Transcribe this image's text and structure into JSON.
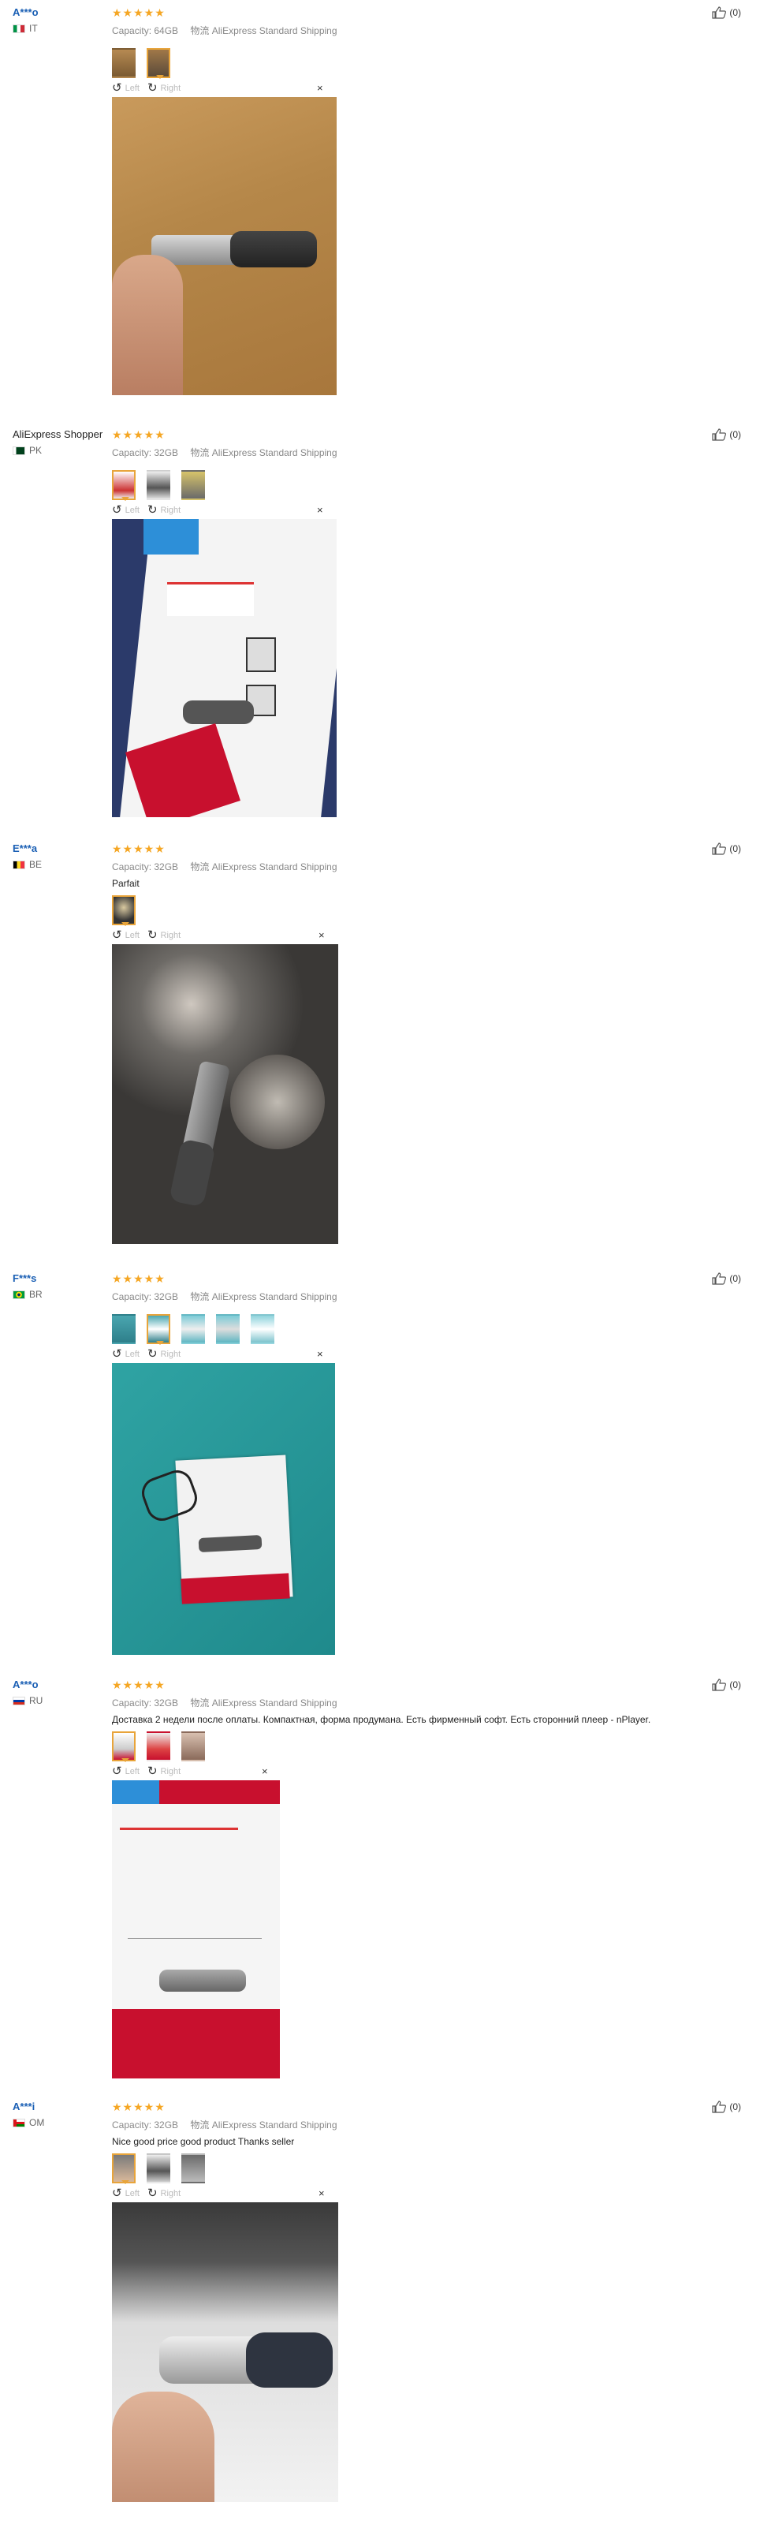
{
  "labels": {
    "capacity": "Capacity:",
    "shipping_icon_text": "物流",
    "rotate_left": "Left",
    "rotate_right": "Right",
    "close": "×"
  },
  "reviews": [
    {
      "user": "A***o",
      "country": "IT",
      "flag_colors": [
        "#009246",
        "#ffffff",
        "#ce2b37"
      ],
      "stars": "★★★★★",
      "capacity": "64GB",
      "shipping": "AliExpress Standard Shipping",
      "content": "",
      "helpful": "(0)",
      "thumb_count": 2,
      "active_thumb": 1
    },
    {
      "user": "AliExpress Shopper",
      "country": "PK",
      "flag_colors": [
        "#ffffff",
        "#01411c",
        "#01411c"
      ],
      "stars": "★★★★★",
      "capacity": "32GB",
      "shipping": "AliExpress Standard Shipping",
      "content": "",
      "helpful": "(0)",
      "thumb_count": 3,
      "active_thumb": 0
    },
    {
      "user": "E***a",
      "country": "BE",
      "flag_colors": [
        "#000000",
        "#fdda24",
        "#ef3340"
      ],
      "stars": "★★★★★",
      "capacity": "32GB",
      "shipping": "AliExpress Standard Shipping",
      "content": "Parfait",
      "helpful": "(0)",
      "thumb_count": 1,
      "active_thumb": 0
    },
    {
      "user": "F***s",
      "country": "BR",
      "flag_colors": [
        "#009c3b",
        "#ffdf00",
        "#009c3b"
      ],
      "stars": "★★★★★",
      "capacity": "32GB",
      "shipping": "AliExpress Standard Shipping",
      "content": "",
      "helpful": "(0)",
      "thumb_count": 5,
      "active_thumb": 1
    },
    {
      "user": "A***o",
      "country": "RU",
      "flag_colors": [
        "#ffffff",
        "#0039a6",
        "#d52b1e"
      ],
      "stars": "★★★★★",
      "capacity": "32GB",
      "shipping": "AliExpress Standard Shipping",
      "content": "Доставка 2 недели после оплаты. Компактная, форма продумана. Есть фирменный софт. Есть сторонний плеер - nPlayer.",
      "helpful": "(0)",
      "thumb_count": 3,
      "active_thumb": 0
    },
    {
      "user": "A***i",
      "country": "OM",
      "flag_colors": [
        "#db161b",
        "#ffffff",
        "#008000"
      ],
      "stars": "★★★★★",
      "capacity": "32GB",
      "shipping": "AliExpress Standard Shipping",
      "content": "Nice good price good product Thanks seller",
      "helpful": "(0)",
      "thumb_count": 3,
      "active_thumb": 0
    }
  ]
}
